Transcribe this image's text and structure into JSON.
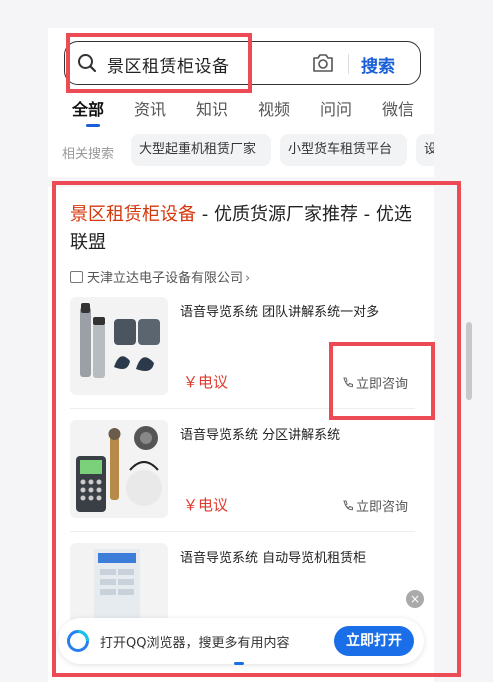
{
  "search": {
    "query": "景区租赁柜设备",
    "button": "搜索"
  },
  "tabs": [
    "全部",
    "资讯",
    "知识",
    "视频",
    "问问",
    "微信"
  ],
  "related": {
    "label": "相关搜索",
    "chips": [
      "大型起重机租赁厂家",
      "小型货车租赁平台",
      "设"
    ]
  },
  "result": {
    "title_keyword": "景区租赁柜设备",
    "title_rest": " - 优质货源厂家推荐 - 优选联盟",
    "source": "天津立达电子设备有限公司",
    "source_chevron": "›",
    "products": [
      {
        "name": "语音导览系统 团队讲解系统一对多",
        "price": "￥电议",
        "consult": "立即咨询"
      },
      {
        "name": "语音导览系统 分区讲解系统",
        "price": "￥电议",
        "consult": "立即咨询"
      },
      {
        "name": "语音导览系统 自动导览机租赁柜",
        "price": "",
        "consult": ""
      }
    ]
  },
  "banner": {
    "text": "打开QQ浏览器，搜更多有用内容",
    "button": "立即打开",
    "close": "×"
  },
  "colors": {
    "accent": "#1a5fd8",
    "highlight": "#ec4b55",
    "keyword": "#d4380d",
    "price": "#e03a2e"
  }
}
